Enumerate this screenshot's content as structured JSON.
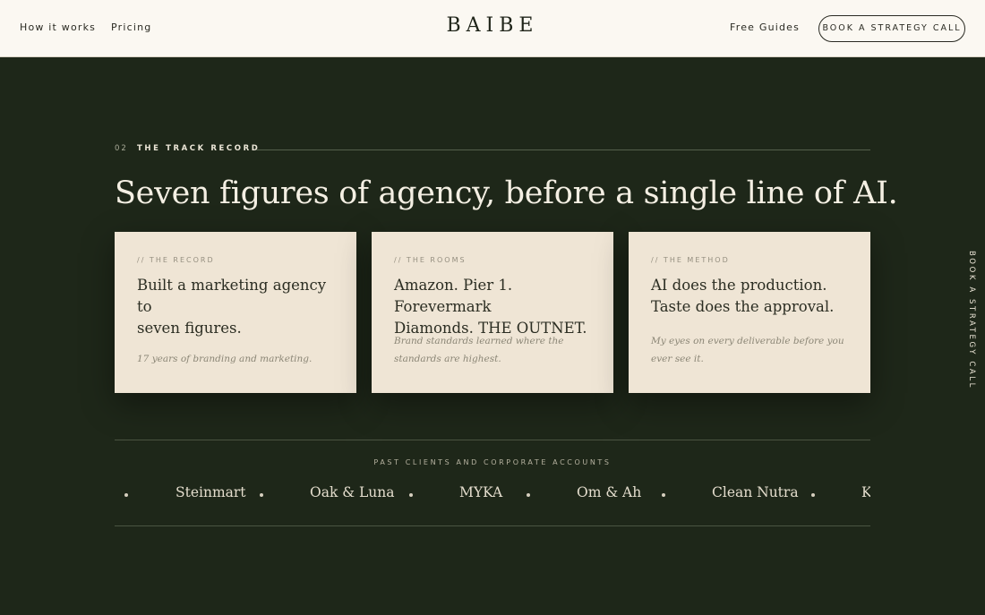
{
  "header": {
    "nav_left": [
      "How it works",
      "Pricing"
    ],
    "logo": "BAIBE",
    "nav_right": "Free Guides",
    "cta_label": "BOOK A STRATEGY CALL"
  },
  "section": {
    "number": "02",
    "eyebrow": "THE TRACK RECORD",
    "headline": "Seven figures of agency, before a single line of AI."
  },
  "cards": [
    {
      "label": "// THE RECORD",
      "title_lines": [
        "Built a marketing agency to",
        "seven figures."
      ],
      "note": "17 years of branding and marketing."
    },
    {
      "label": "// THE ROOMS",
      "title_lines": [
        "Amazon. Pier 1. Forevermark",
        "Diamonds. THE OUTNET."
      ],
      "note": "Brand standards learned where the standards are highest."
    },
    {
      "label": "// THE METHOD",
      "title_lines": [
        "AI does the production.",
        "Taste does the approval."
      ],
      "note": "My eyes on every deliverable before you ever see it."
    }
  ],
  "side_tab": {
    "label": "BOOK A STRATEGY CALL"
  },
  "clients": {
    "label": "PAST CLIENTS AND CORPORATE ACCOUNTS",
    "names": [
      "Steinmart",
      "Oak & Luna",
      "MYKA",
      "Om & Ah",
      "Clean Nutra",
      "K"
    ]
  },
  "colors": {
    "page_background": "#1e2719",
    "header_background": "#fbf8f2",
    "card_background": "#efe5d5",
    "headline_text": "#f4efe3"
  }
}
